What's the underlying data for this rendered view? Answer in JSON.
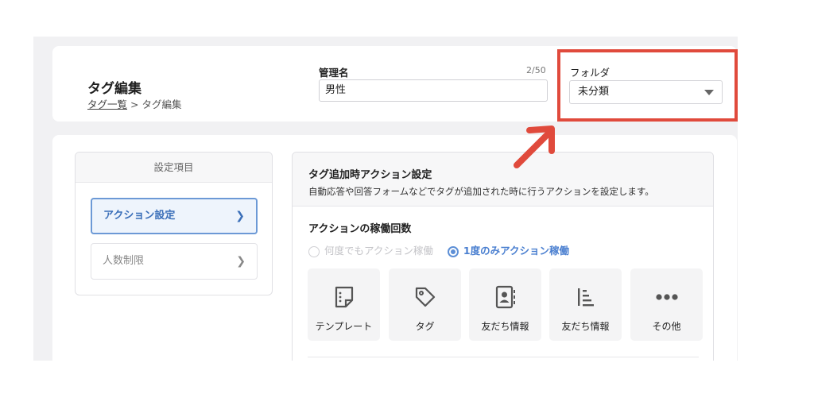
{
  "header": {
    "page_title": "タグ編集",
    "breadcrumb": {
      "link": "タグ一覧",
      "separator": ">",
      "current": "タグ編集"
    },
    "admin_name": {
      "label": "管理名",
      "value": "男性",
      "counter": "2/50"
    },
    "folder": {
      "label": "フォルダ",
      "selected": "未分類"
    }
  },
  "sidebar": {
    "heading": "設定項目",
    "items": [
      {
        "label": "アクション設定",
        "active": true
      },
      {
        "label": "人数制限",
        "active": false
      }
    ]
  },
  "content": {
    "title": "タグ追加時アクション設定",
    "description": "自動応答や回答フォームなどでタグが追加された時に行うアクションを設定します。",
    "section_title": "アクションの稼働回数",
    "radio_options": [
      {
        "label": "何度でもアクション稼働",
        "checked": false
      },
      {
        "label": "1度のみアクション稼働",
        "checked": true
      }
    ],
    "tiles": [
      {
        "label": "テンプレート",
        "icon": "template-icon"
      },
      {
        "label": "タグ",
        "icon": "tag-icon"
      },
      {
        "label": "友だち情報",
        "icon": "contact-card-icon"
      },
      {
        "label": "友だち情報",
        "icon": "list-sort-icon"
      },
      {
        "label": "その他",
        "icon": "more-dots-icon"
      }
    ]
  },
  "colors": {
    "accent_blue": "#5d8fd6",
    "annotation_red": "#e04a3c",
    "background_gray": "#f1f1f3"
  }
}
